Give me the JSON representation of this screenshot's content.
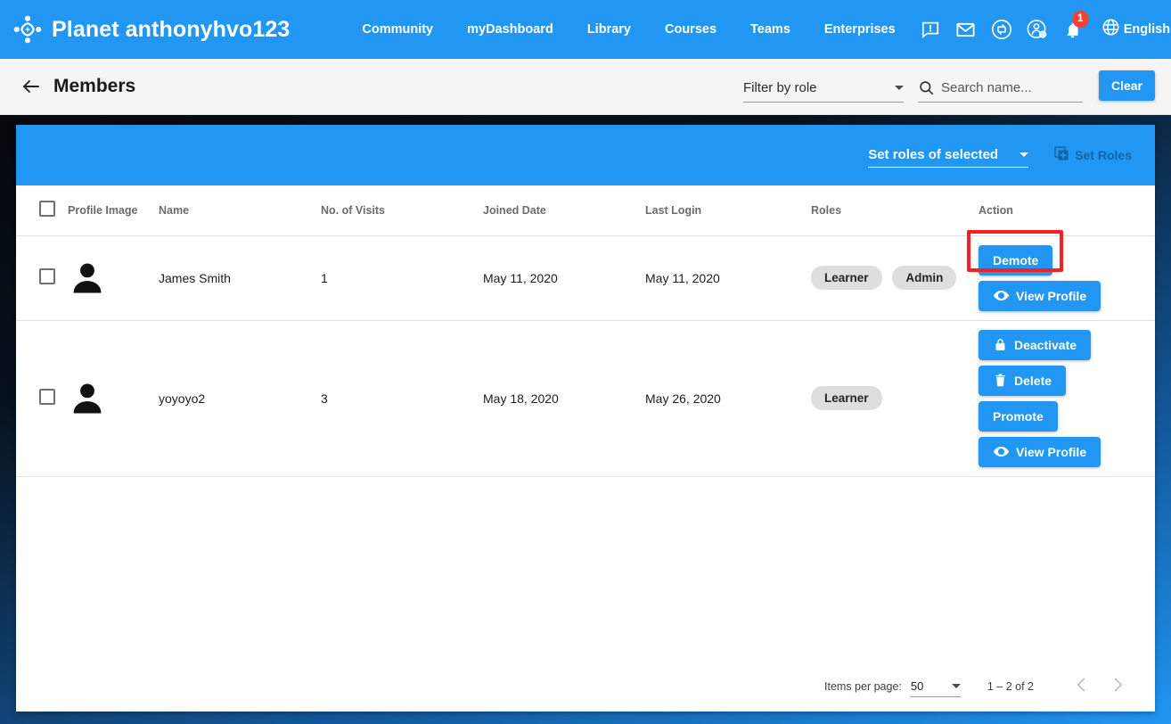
{
  "topnav": {
    "logo_icon": "planet-logo-icon",
    "brand_title": "Planet anthonyhvo123",
    "links": [
      {
        "label": "Community",
        "name": "nav-community"
      },
      {
        "label": "myDashboard",
        "name": "nav-mydashboard"
      },
      {
        "label": "Library",
        "name": "nav-library"
      },
      {
        "label": "Courses",
        "name": "nav-courses"
      },
      {
        "label": "Teams",
        "name": "nav-teams"
      },
      {
        "label": "Enterprises",
        "name": "nav-enterprises"
      }
    ],
    "icons": [
      {
        "name": "feedback-icon"
      },
      {
        "name": "mail-icon"
      },
      {
        "name": "sync-icon"
      },
      {
        "name": "user-settings-icon"
      },
      {
        "name": "bell-icon"
      }
    ],
    "notification_count": "1",
    "language_label": "English",
    "language_icon": "globe-icon",
    "account_icon": "account-circle-icon",
    "accent_color": "#2196f3",
    "badge_color": "#f44336"
  },
  "subheader": {
    "back_icon": "arrow-back-icon",
    "title": "Members",
    "filter_label": "Filter by role",
    "search_icon": "search-icon",
    "search_value": "",
    "search_placeholder": "Search name...",
    "clear_label": "Clear"
  },
  "toolbar": {
    "set_roles_select_label": "Set roles of selected",
    "set_roles_button_label": "Set Roles",
    "set_roles_icon": "add-box-icon",
    "set_roles_disabled": true
  },
  "table": {
    "headers": [
      "Profile Image",
      "Name",
      "No. of Visits",
      "Joined Date",
      "Last Login",
      "Roles",
      "Action"
    ],
    "rows": [
      {
        "name": "James Smith",
        "visits": "1",
        "joined": "May 11, 2020",
        "last_login": "May 11, 2020",
        "roles": [
          "Learner",
          "Admin"
        ],
        "actions": [
          {
            "label": "Demote",
            "icon": "",
            "name": "demote-button",
            "highlighted": true
          },
          {
            "label": "View Profile",
            "icon": "eye-icon",
            "name": "view-profile-button"
          }
        ]
      },
      {
        "name": "yoyoyo2",
        "visits": "3",
        "joined": "May 18, 2020",
        "last_login": "May 26, 2020",
        "roles": [
          "Learner"
        ],
        "actions": [
          {
            "label": "Deactivate",
            "icon": "lock-icon",
            "name": "deactivate-button"
          },
          {
            "label": "Delete",
            "icon": "trash-icon",
            "name": "delete-button"
          },
          {
            "label": "Promote",
            "icon": "",
            "name": "promote-button"
          },
          {
            "label": "View Profile",
            "icon": "eye-icon",
            "name": "view-profile-button"
          }
        ]
      }
    ]
  },
  "paginator": {
    "items_per_page_label": "Items per page:",
    "items_per_page_value": "50",
    "range_label": "1 – 2 of 2",
    "prev_icon": "chevron-left-icon",
    "next_icon": "chevron-right-icon"
  },
  "highlight": {
    "color": "#f72020",
    "target": "demote-button"
  }
}
